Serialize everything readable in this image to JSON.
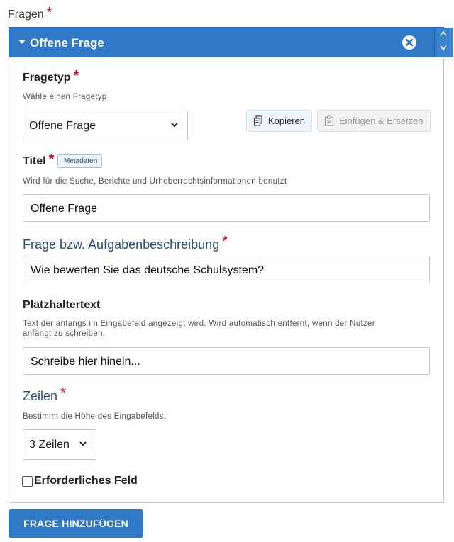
{
  "section": {
    "label": "Fragen",
    "required_mark": "*"
  },
  "panel": {
    "title": "Offene Frage",
    "close_icon": "close-circle-icon",
    "sort_up_icon": "chevron-up-icon",
    "sort_down_icon": "chevron-down-icon",
    "header_color": "#2f79c7"
  },
  "question_type": {
    "label": "Fragetyp",
    "required_mark": "*",
    "hint": "Wähle einen Fragetyp",
    "selected": "Offene Frage",
    "copy_label": "Kopieren",
    "paste_label": "Einfügen & Ersetzen"
  },
  "title_field": {
    "label": "Titel",
    "required_mark": "*",
    "badge": "Metadaten",
    "hint": "Wird für die Suche, Berichte und Urheberrechtsinformationen benutzt",
    "value": "Offene Frage"
  },
  "question_text": {
    "label": "Frage bzw. Aufgabenbeschreibung",
    "required_mark": "*",
    "value": "Wie bewerten Sie das deutsche Schulsystem?"
  },
  "placeholder_field": {
    "label": "Platzhaltertext",
    "hint_line1": "Text der anfangs im Eingabefeld angezeigt wird. Wird automatisch entfernt, wenn der Nutzer",
    "hint_line2": "anfängt zu schreiben.",
    "value": "Schreibe hier hinein..."
  },
  "rows_field": {
    "label": "Zeilen",
    "required_mark": "*",
    "hint": "Bestimmt die Höhe des Eingabefelds.",
    "selected": "3 Zeilen"
  },
  "required_checkbox": {
    "label": "Erforderliches Feld",
    "checked": false
  },
  "add_button": {
    "label": "FRAGE HINZUFÜGEN"
  }
}
